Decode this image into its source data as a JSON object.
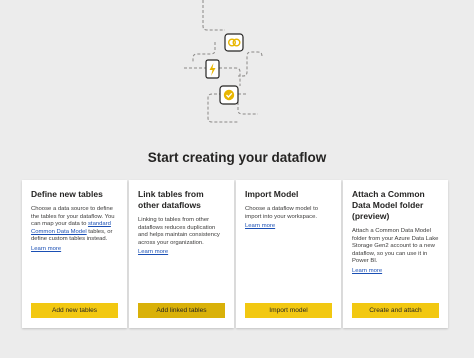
{
  "heading": "Start creating your dataflow",
  "cards": [
    {
      "title": "Define new tables",
      "desc_before": "Choose a data source to define the tables for your dataflow. You can map your data to ",
      "desc_link": "standard Common Data Model",
      "desc_after": " tables, or define custom tables instead.",
      "learn_more": "Learn more",
      "button": "Add new tables"
    },
    {
      "title": "Link tables from other dataflows",
      "desc": "Linking to tables from other dataflows reduces duplication and helps maintain consistency across your organization.",
      "learn_more": "Learn more",
      "button": "Add linked tables"
    },
    {
      "title": "Import Model",
      "desc": "Choose a dataflow model to import into your workspace.",
      "learn_more": "Learn more",
      "button": "Import model"
    },
    {
      "title": "Attach a Common Data Model folder (preview)",
      "desc": "Attach a Common Data Model folder from your Azure Data Lake Storage Gen2 account to a new dataflow, so you can use it in Power BI.",
      "learn_more": "Learn more",
      "button": "Create and attach"
    }
  ],
  "colors": {
    "accent": "#f2c811",
    "link": "#1a4fb4",
    "background": "#ececec"
  },
  "illustration_icons": [
    "link-icon",
    "lightning-icon",
    "check-icon"
  ]
}
